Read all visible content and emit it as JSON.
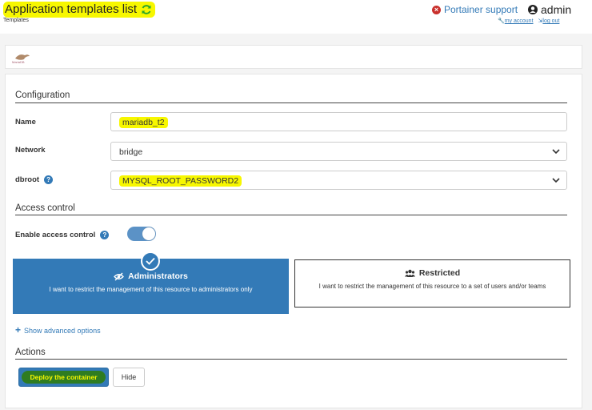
{
  "header": {
    "title": "Application templates list",
    "breadcrumb": "Templates",
    "support_label": "Portainer support",
    "username": "admin",
    "my_account": "my account",
    "log_out": "log out"
  },
  "template": {
    "logo_text": "MariaDB"
  },
  "configuration": {
    "section_title": "Configuration",
    "name_label": "Name",
    "name_value": "mariadb_t2",
    "network_label": "Network",
    "network_value": "bridge",
    "dbroot_label": "dbroot",
    "dbroot_value": "MYSQL_ROOT_PASSWORD2"
  },
  "access_control": {
    "section_title": "Access control",
    "enable_label": "Enable access control",
    "enabled": true,
    "admin_title": "Administrators",
    "admin_desc": "I want to restrict the management of this resource to administrators only",
    "restricted_title": "Restricted",
    "restricted_desc": "I want to restrict the management of this resource to a set of users and/or teams",
    "selected": "Administrators"
  },
  "advanced": {
    "label": "Show advanced options"
  },
  "actions": {
    "section_title": "Actions",
    "deploy_label": "Deploy the container",
    "hide_label": "Hide"
  },
  "colors": {
    "primary": "#337ab7",
    "highlight": "#f7f700",
    "danger": "#c9302c"
  }
}
